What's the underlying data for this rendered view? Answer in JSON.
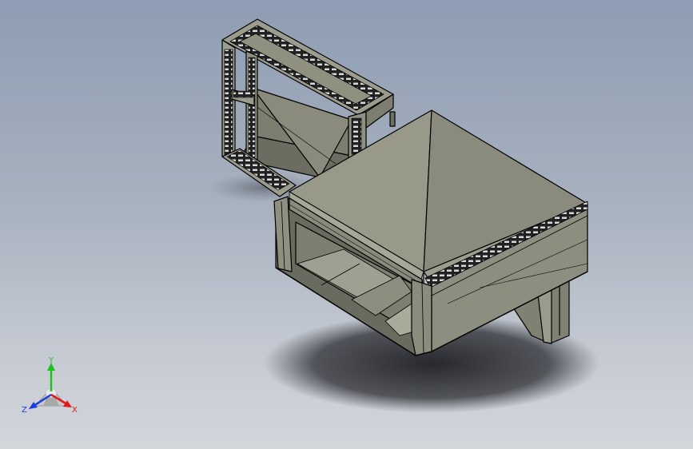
{
  "viewport": {
    "background_top": "#8e9db3",
    "background_bottom": "#d3d6db"
  },
  "model": {
    "face_color": "#8f9080",
    "face_light": "#a2a394",
    "face_dark": "#6f7062",
    "edge_color": "#000000",
    "shadow_color": "#2a2c31"
  },
  "triad": {
    "x_label": "X",
    "y_label": "Y",
    "z_label": "Z",
    "x_color": "#e01a1a",
    "y_color": "#1ec21e",
    "z_color": "#1a3fe0"
  }
}
